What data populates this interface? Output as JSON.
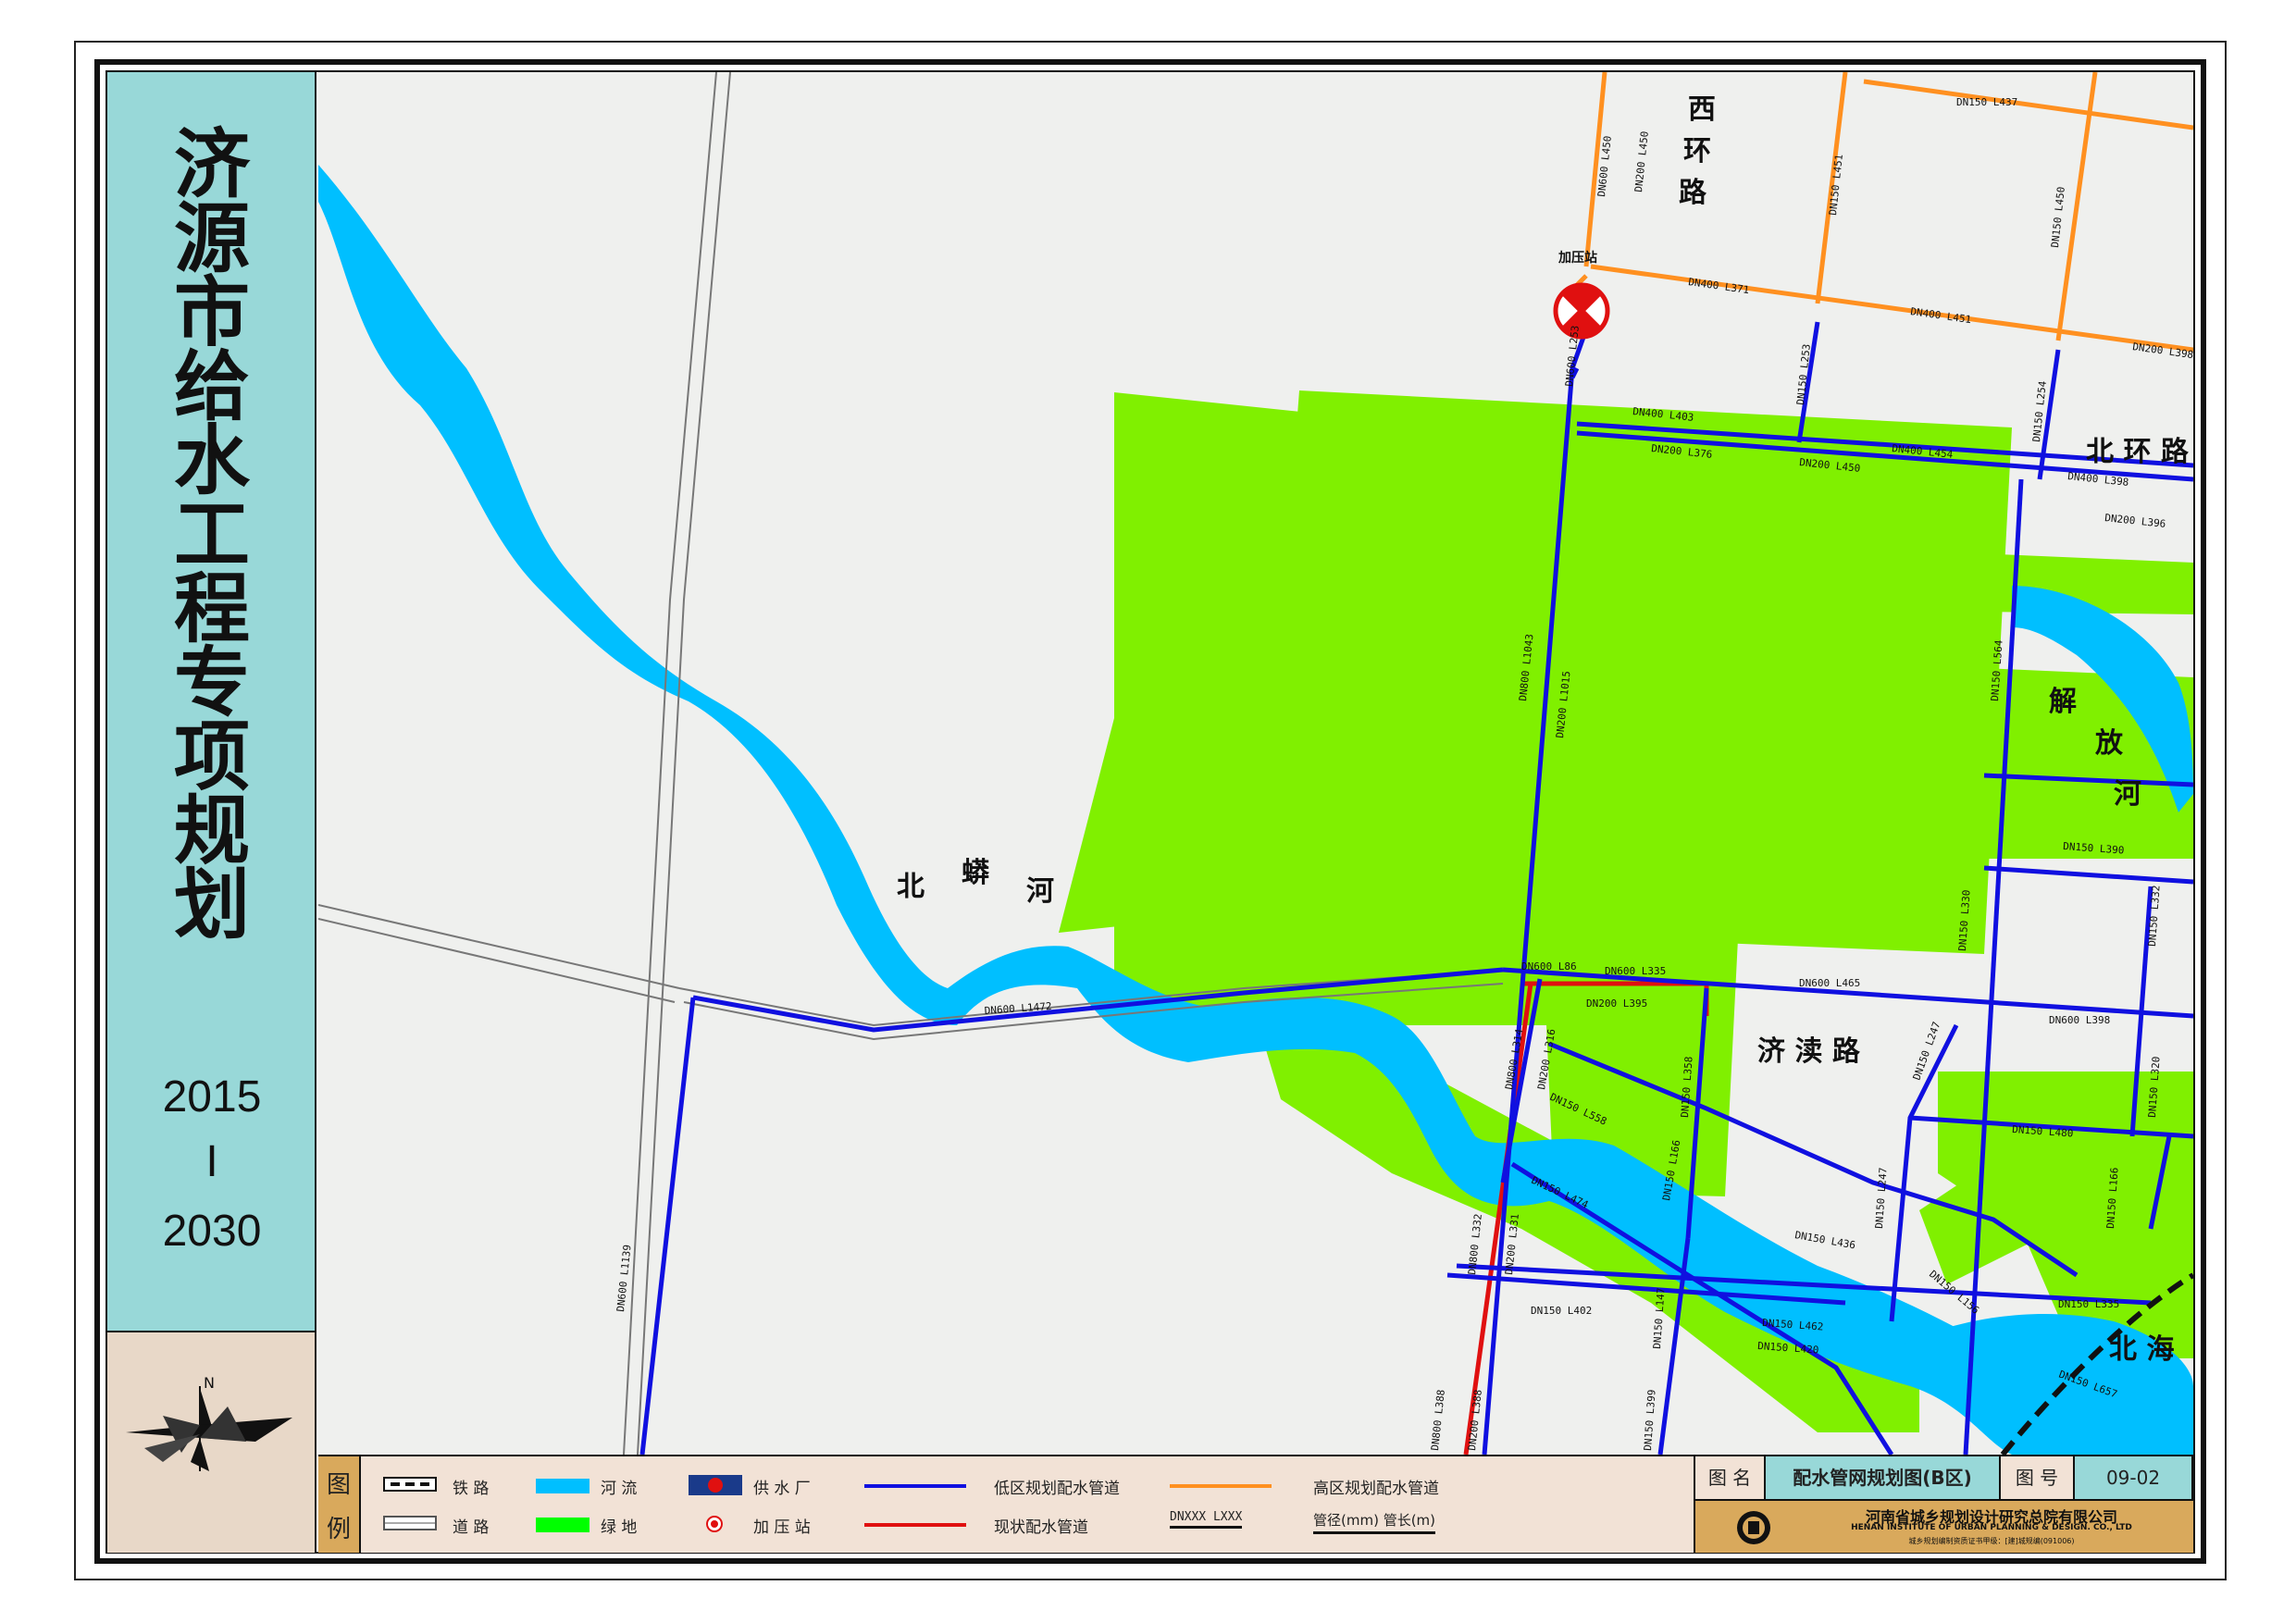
{
  "title": {
    "main_chars": [
      "济",
      "源",
      "市",
      "给",
      "水",
      "工",
      "程",
      "专",
      "项",
      "规",
      "划"
    ],
    "year_start": "2015",
    "year_sep": "I",
    "year_end": "2030"
  },
  "compass": {
    "north_label": "N"
  },
  "map_labels": {
    "xihuan_road": [
      "西",
      "环",
      "路"
    ],
    "beihuan_road": "北 环 路",
    "jidu_road": "济 渎 路",
    "jiefang_river": [
      "解",
      "放",
      "河"
    ],
    "beimang_river": [
      "北",
      "蟒",
      "河"
    ],
    "beihai": "北 海",
    "booster_station": "加压站"
  },
  "pipe_labels": [
    "DN150 L437",
    "DN600 L450",
    "DN200 L450",
    "DN150 L451",
    "DN150 L450",
    "DN400 L371",
    "DN400 L451",
    "DN200 L398",
    "DN600 L253",
    "DN150 L253",
    "DN150 L254",
    "DN400 L403",
    "DN400 L454",
    "DN400 L398",
    "DN200 L376",
    "DN200 L450",
    "DN200 L396",
    "DN800 L1043",
    "DN200 L1015",
    "DN150 L564",
    "DN150 L390",
    "DN150 L330",
    "DN150 L332",
    "DN600 L86",
    "DN600 L335",
    "DN600 L465",
    "DN600 L398",
    "DN600 L1472",
    "DN200 L395",
    "DN800 L314",
    "DN200 L316",
    "DN150 L558",
    "DN150 L358",
    "DN150 L247",
    "DN150 L320",
    "DN150 L480",
    "DN150 L474",
    "DN150 L166",
    "DN800 L332",
    "DN200 L331",
    "DN150 L436",
    "DN150 L247",
    "DN150 L166",
    "DN150 L156",
    "DN150 L335",
    "DN150 L402",
    "DN150 L147",
    "DN150 L462",
    "DN150 L420",
    "DN800 L388",
    "DN200 L388",
    "DN150 L399",
    "DN600 L1139",
    "DN150 L657"
  ],
  "legend": {
    "head_top": "图",
    "head_bottom": "例",
    "railway": "铁 路",
    "road": "道 路",
    "river": "河 流",
    "green": "绿 地",
    "water_plant": "供 水 厂",
    "booster": "加 压 站",
    "low_zone_pipe": "低区规划配水管道",
    "existing_pipe": "现状配水管道",
    "high_zone_pipe": "高区规划配水管道",
    "dn_example": "DNXXX  LXXX",
    "dn_explain": "管径(mm) 管长(m)"
  },
  "title_block": {
    "name_label": "图 名",
    "name_value": "配水管网规划图(B区)",
    "number_label": "图 号",
    "number_value": "09-02",
    "institute_cn": "河南省城乡规划设计研究总院有限公司",
    "institute_en": "HENAN INSTITUTE OF URBAN PLANNING & DESIGN. CO., LTD",
    "certificate": "城乡规划编制资质证书甲级：[建]城规编(091006)"
  },
  "colors": {
    "title_panel": "#98d8d8",
    "river": "#00bfff",
    "green": "#80f000",
    "low_pipe": "#1010e0",
    "high_pipe": "#ff9020",
    "existing_pipe": "#e01010",
    "map_bg": "#eff0ee"
  }
}
